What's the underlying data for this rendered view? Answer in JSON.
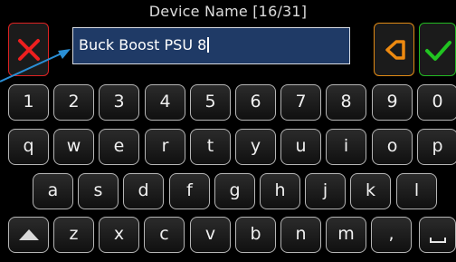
{
  "header": {
    "title": "Device Name [16/31]"
  },
  "input": {
    "value": "Buck Boost PSU 8"
  },
  "actions": {
    "cancel_icon": "close-icon",
    "backspace_icon": "backspace-icon",
    "confirm_icon": "check-icon"
  },
  "colors": {
    "cancel": "#dd2222",
    "backspace": "#e08a15",
    "confirm": "#22b822",
    "input_bg": "#1f3a66"
  },
  "keyboard": {
    "row1": [
      "1",
      "2",
      "3",
      "4",
      "5",
      "6",
      "7",
      "8",
      "9",
      "0"
    ],
    "row2": [
      "q",
      "w",
      "e",
      "r",
      "t",
      "y",
      "u",
      "i",
      "o",
      "p"
    ],
    "row3": [
      "a",
      "s",
      "d",
      "f",
      "g",
      "h",
      "j",
      "k",
      "l"
    ],
    "row4": [
      "z",
      "x",
      "c",
      "v",
      "b",
      "n",
      "m",
      ","
    ],
    "shift_icon": "shift-icon",
    "space_icon": "space-icon"
  }
}
